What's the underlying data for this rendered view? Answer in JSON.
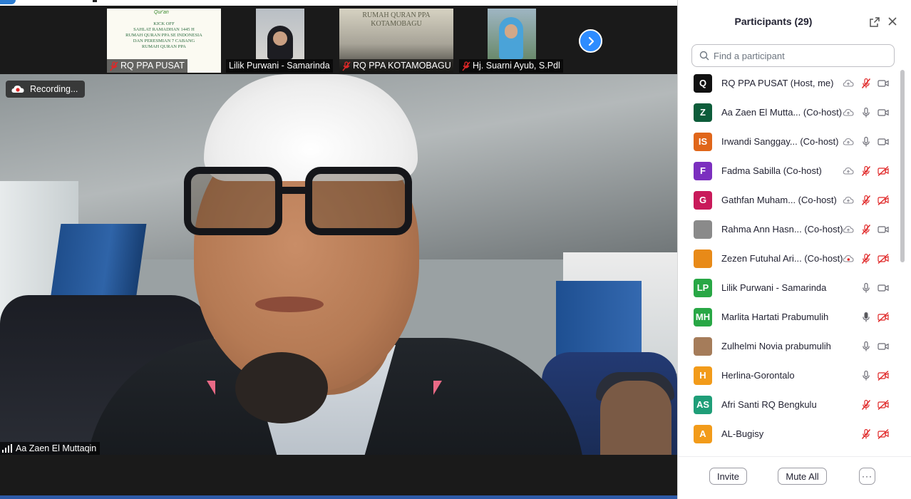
{
  "window": {
    "accent": "#2d8cff"
  },
  "thumbnails": [
    {
      "name": "RQ PPA PUSAT",
      "muted": true,
      "poster_logo": "Qur'an",
      "poster_text": [
        "KICK OFF",
        "SAHLAT RAMADHAN 1445 H",
        "RUMAH QURAN PPA SE INDONESIA",
        "DAN PERESMIAN 7 CABANG",
        "RUMAH QURAN PPA"
      ]
    },
    {
      "name": "Lilik Purwani - Samarinda",
      "muted": false
    },
    {
      "name": "RQ PPA KOTAMOBAGU |",
      "muted": true,
      "banner_text": [
        "RUMAH QURAN PPA",
        "KOTAMOBAGU"
      ]
    },
    {
      "name": "Hj. Suarni Ayub, S.Pdl",
      "muted": true
    }
  ],
  "recording": {
    "label": "Recording..."
  },
  "main_video": {
    "speaker_name": "Aa Zaen El Muttaqin"
  },
  "panel": {
    "title": "Participants (29)",
    "search_placeholder": "Find a participant",
    "invite_label": "Invite",
    "mute_all_label": "Mute All",
    "more_label": "···"
  },
  "participants": [
    {
      "initials": "Q",
      "color": "#111111",
      "name": "RQ PPA PUSAT (Host, me)",
      "cloud": true,
      "mic": "off",
      "video": "on"
    },
    {
      "initials": "Z",
      "color": "#0d5c3a",
      "name": "Aa Zaen El Mutta... (Co-host)",
      "cloud": true,
      "mic": "on",
      "video": "on"
    },
    {
      "initials": "IS",
      "color": "#e0661a",
      "name": "Irwandi Sanggay... (Co-host)",
      "cloud": true,
      "mic": "on",
      "video": "on"
    },
    {
      "initials": "F",
      "color": "#7b2fbf",
      "name": "Fadma Sabilla (Co-host)",
      "cloud": true,
      "mic": "off",
      "video": "off"
    },
    {
      "initials": "G",
      "color": "#c91a5a",
      "name": "Gathfan Muham... (Co-host)",
      "cloud": true,
      "mic": "off",
      "video": "off"
    },
    {
      "initials": "",
      "color": "#8a8a8a",
      "name": "Rahma Ann Hasn... (Co-host)",
      "cloud": true,
      "mic": "off",
      "video": "on"
    },
    {
      "initials": "",
      "color": "#e88a18",
      "name": "Zezen Futuhal Ari... (Co-host)",
      "cloud": true,
      "cloud_red": true,
      "mic": "off",
      "video": "off"
    },
    {
      "initials": "LP",
      "color": "#28a745",
      "name": "Lilik Purwani - Samarinda",
      "cloud": false,
      "mic": "on",
      "video": "on"
    },
    {
      "initials": "MH",
      "color": "#28a745",
      "name": "Marlita Hartati Prabumulih",
      "cloud": false,
      "mic": "on-dark",
      "video": "off"
    },
    {
      "initials": "",
      "color": "#a57c5a",
      "name": "Zulhelmi Novia prabumulih",
      "cloud": false,
      "mic": "on",
      "video": "on"
    },
    {
      "initials": "H",
      "color": "#f29b1a",
      "name": "Herlina-Gorontalo",
      "cloud": false,
      "mic": "on",
      "video": "off"
    },
    {
      "initials": "AS",
      "color": "#1f9e78",
      "name": "Afri Santi RQ Bengkulu",
      "cloud": false,
      "mic": "off",
      "video": "off"
    },
    {
      "initials": "A",
      "color": "#f29b1a",
      "name": "AL-Bugisy",
      "cloud": false,
      "mic": "off",
      "video": "off"
    }
  ]
}
